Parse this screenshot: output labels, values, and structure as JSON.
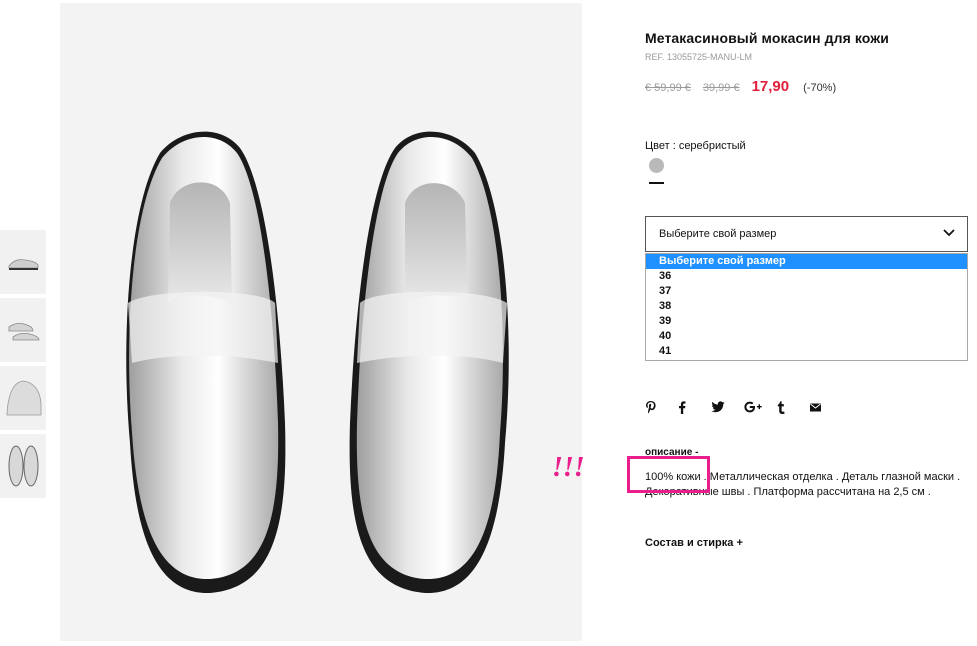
{
  "product": {
    "title": "Метакасиновый мокасин для кожи",
    "ref": "REF. 13055725-MANU-LM",
    "price_original": "€ 59,99 €",
    "price_previous": "39,99 €",
    "price_current": "17,90",
    "discount": "(-70%)"
  },
  "color": {
    "label": "Цвет : серебристый",
    "swatch_color": "#b9b9b9"
  },
  "size": {
    "placeholder": "Выберите свой размер",
    "options": [
      "Выберите свой размер",
      "36",
      "37",
      "38",
      "39",
      "40",
      "41"
    ],
    "highlighted_index": 0
  },
  "social_icons": [
    "pinterest-icon",
    "facebook-icon",
    "twitter-icon",
    "google-plus-icon",
    "tumblr-icon",
    "email-icon"
  ],
  "description": {
    "heading": "описание -",
    "text": "100% кожи . Металлическая отделка . Деталь глазной маски . Декоративные швы . Платформа рассчитана на 2,5 см ."
  },
  "composition": {
    "label": "Состав и стирка +"
  },
  "annotation": {
    "marks": "!!!",
    "color": "#e91e8c"
  },
  "colors": {
    "sale": "#e0203a",
    "highlight": "#1e90ff"
  }
}
